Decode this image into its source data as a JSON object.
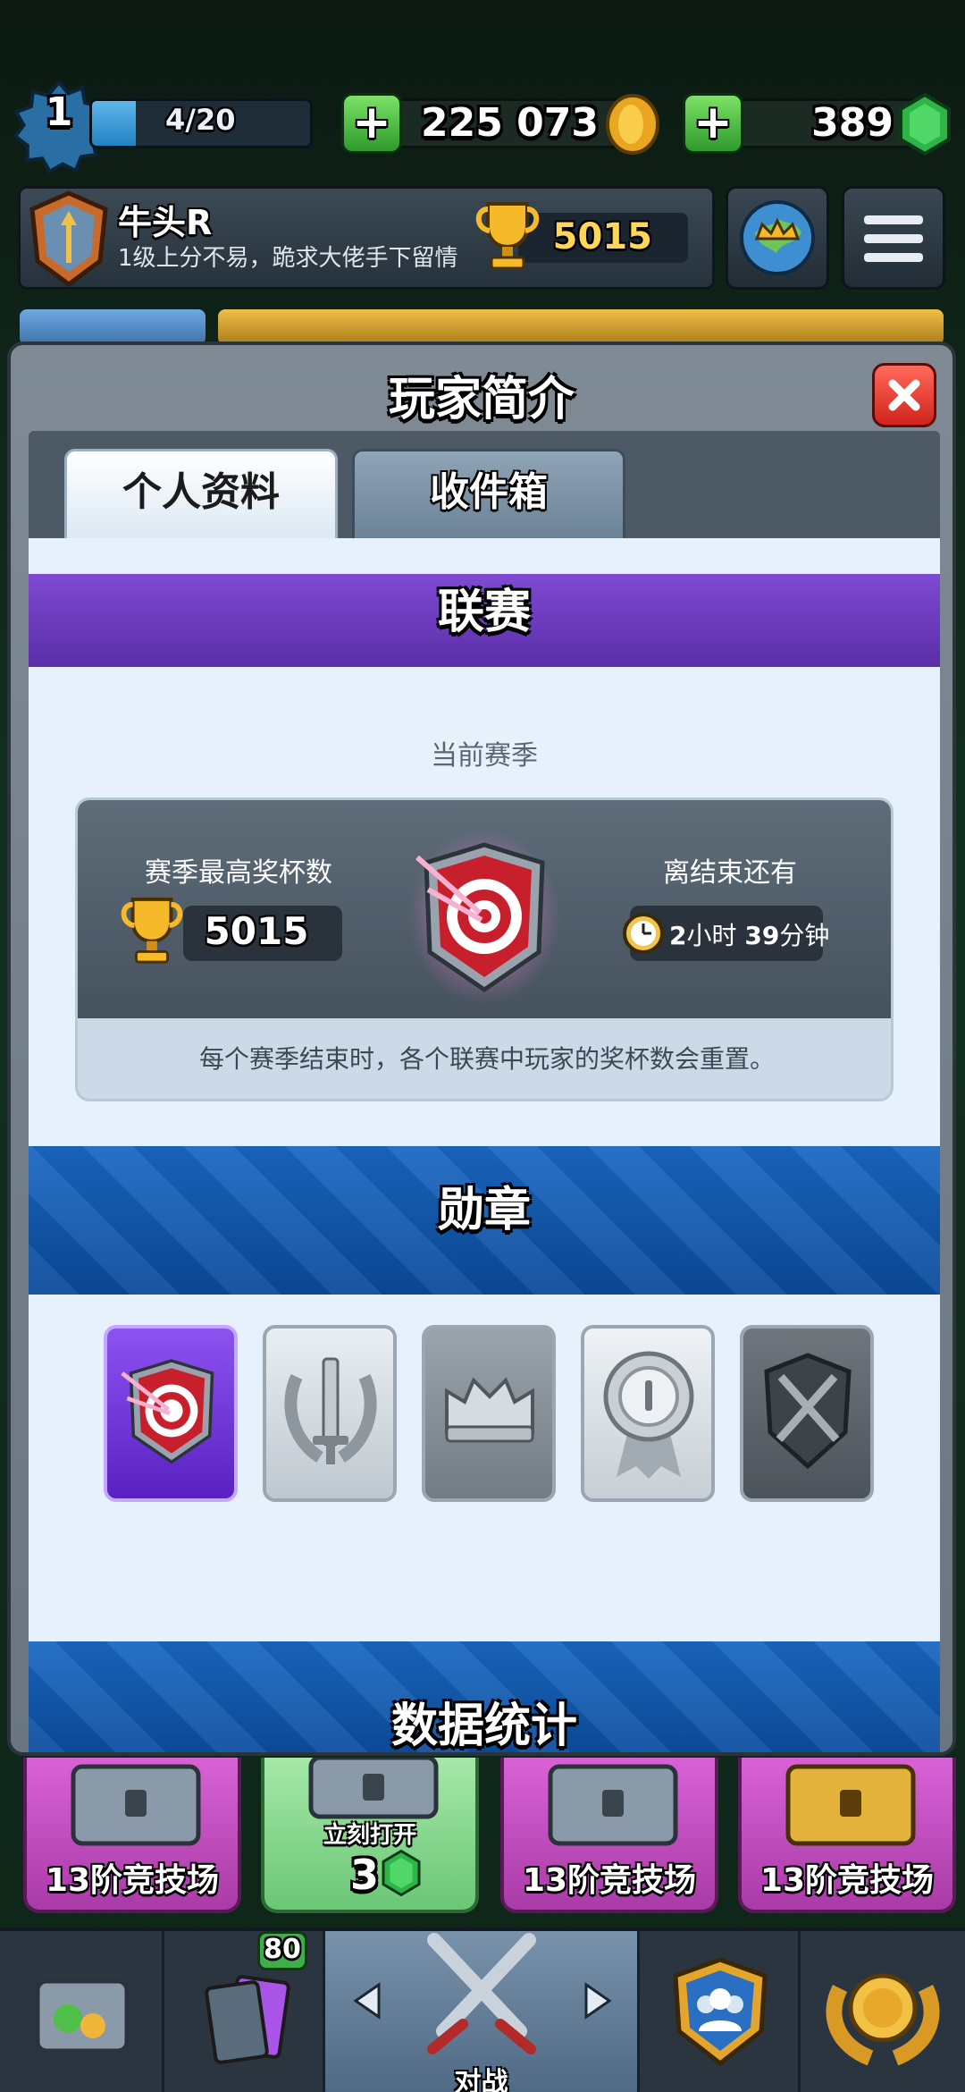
{
  "topbar": {
    "level": "1",
    "xp_text": "4/20",
    "xp_progress": 0.2,
    "gold": "225 073",
    "gems": "389"
  },
  "profile": {
    "name": "牛头R",
    "motto": "1级上分不易，跪求大佬手下留情",
    "trophies": "5015"
  },
  "modal": {
    "title": "玩家简介",
    "tabs": [
      {
        "label": "个人资料",
        "active": true
      },
      {
        "label": "收件箱",
        "active": false
      }
    ],
    "league": {
      "header": "联赛",
      "season_label": "当前赛季",
      "best_label": "赛季最高奖杯数",
      "best_value": "5015",
      "ends_label": "离结束还有",
      "ends_hours": "2",
      "ends_hours_unit": "小时",
      "ends_minutes": "39",
      "ends_minutes_unit": "分钟",
      "note": "每个赛季结束时，各个联赛中玩家的奖杯数会重置。"
    },
    "badges": {
      "header": "勋章",
      "items": [
        {
          "icon": "target-shield-icon",
          "unlocked": true
        },
        {
          "icon": "laurel-sword-icon",
          "unlocked": false
        },
        {
          "icon": "crown-icon",
          "unlocked": false
        },
        {
          "icon": "medal-icon",
          "unlocked": false
        },
        {
          "icon": "crossed-swords-shield-icon",
          "unlocked": false
        }
      ]
    },
    "stats": {
      "header": "数据统计"
    }
  },
  "chests": [
    {
      "label": "13阶竞技场",
      "color": "#c84fc7"
    },
    {
      "label_top": "立刻打开",
      "cost": "3",
      "color": "#7ed686"
    },
    {
      "label": "13阶竞技场",
      "color": "#c84fc7"
    },
    {
      "label": "13阶竞技场",
      "color": "#c84fc7"
    }
  ],
  "nav": {
    "cards_badge": "80",
    "battle_label": "对战"
  },
  "colors": {
    "league_purple": "#6a3cbc",
    "badge_blue": "#1259b0",
    "gem_green": "#2fb447",
    "gold": "#f2b632"
  }
}
